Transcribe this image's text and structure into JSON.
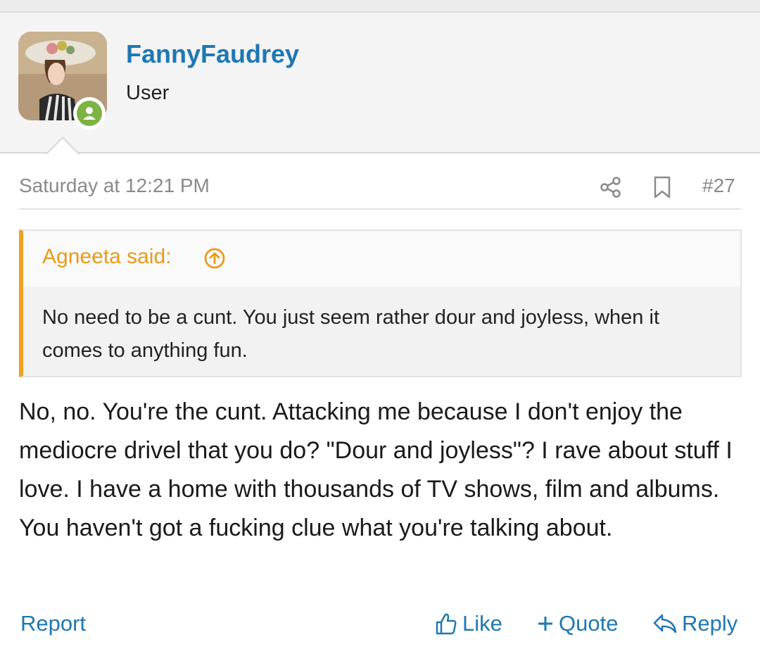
{
  "user": {
    "name": "FannyFaudrey",
    "title": "User"
  },
  "post": {
    "timestamp": "Saturday at 12:21 PM",
    "number": "#27",
    "quote": {
      "author": "Agneeta said:",
      "text": "No need to be a cunt. You just seem rather dour and joyless, when it comes to anything fun."
    },
    "body": "No, no. You're the cunt. Attacking me because I don't enjoy the mediocre drivel that you do? \"Dour and joyless\"? I rave about stuff I love. I have a home with thousands of TV shows, film and albums. You haven't got a fucking clue what you're talking about."
  },
  "actions": {
    "report": "Report",
    "like": "Like",
    "quote": "Quote",
    "reply": "Reply"
  },
  "colors": {
    "link": "#1e78b4",
    "quote_accent": "#f0a020",
    "online": "#7cb342"
  }
}
